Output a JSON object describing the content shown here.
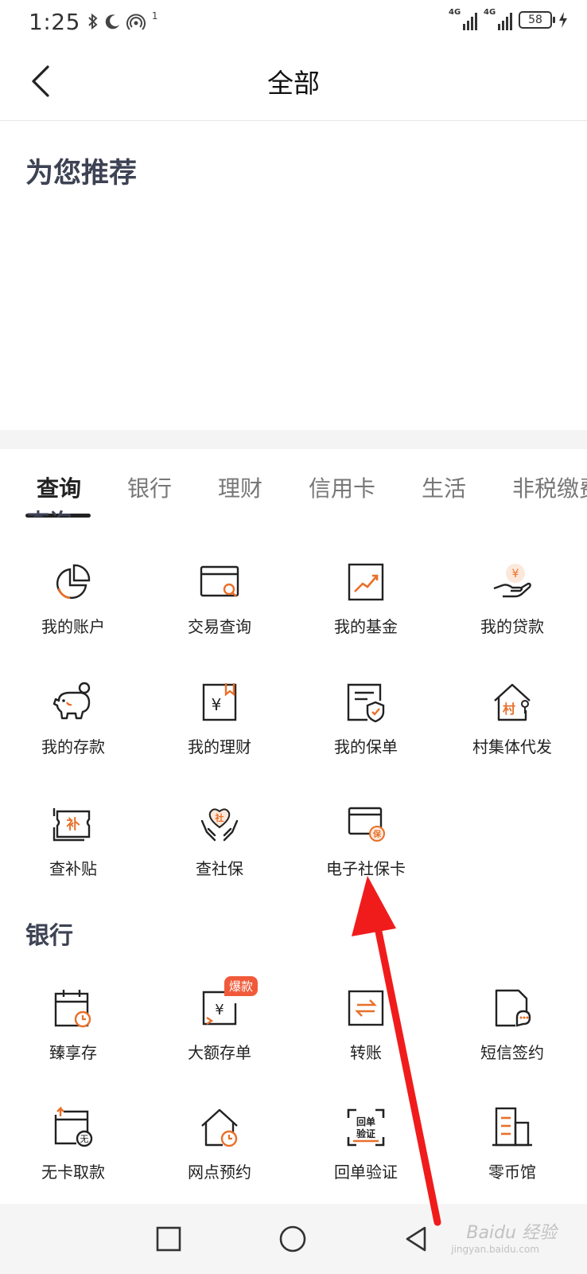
{
  "status_bar": {
    "time": "1:25",
    "left_icons": [
      "bluetooth-icon",
      "moon-icon",
      "hotspot-icon"
    ],
    "hotspot_count": "1",
    "network_tag_1": "4G",
    "network_tag_2": "4G",
    "battery": "58",
    "charging": true
  },
  "header": {
    "title": "全部"
  },
  "recommend": {
    "title": "为您推荐"
  },
  "tabs": [
    {
      "label": "查询",
      "active": true
    },
    {
      "label": "银行",
      "active": false
    },
    {
      "label": "理财",
      "active": false
    },
    {
      "label": "信用卡",
      "active": false
    },
    {
      "label": "生活",
      "active": false
    },
    {
      "label": "非税缴费",
      "active": false
    }
  ],
  "ghost_heading": "查询",
  "sections": [
    {
      "title": "",
      "items": [
        {
          "label": "我的账户",
          "icon": "pie-chart-icon"
        },
        {
          "label": "交易查询",
          "icon": "card-search-icon"
        },
        {
          "label": "我的基金",
          "icon": "trend-chart-icon"
        },
        {
          "label": "我的贷款",
          "icon": "hand-coin-icon"
        },
        {
          "label": "我的存款",
          "icon": "piggy-bank-icon"
        },
        {
          "label": "我的理财",
          "icon": "yuan-bookmark-icon"
        },
        {
          "label": "我的保单",
          "icon": "policy-shield-icon"
        },
        {
          "label": "村集体代发",
          "icon": "village-house-icon"
        },
        {
          "label": "查补贴",
          "icon": "subsidy-ticket-icon"
        },
        {
          "label": "查社保",
          "icon": "social-security-heart-icon"
        },
        {
          "label": "电子社保卡",
          "icon": "social-security-card-icon"
        }
      ]
    },
    {
      "title": "银行",
      "items": [
        {
          "label": "臻享存",
          "icon": "calendar-clock-icon"
        },
        {
          "label": "大额存单",
          "icon": "deposit-certificate-icon",
          "badge": "爆款"
        },
        {
          "label": "转账",
          "icon": "transfer-icon"
        },
        {
          "label": "短信签约",
          "icon": "sms-document-icon"
        },
        {
          "label": "无卡取款",
          "icon": "cardless-withdraw-icon"
        },
        {
          "label": "网点预约",
          "icon": "branch-appointment-icon"
        },
        {
          "label": "回单验证",
          "icon": "receipt-verify-icon",
          "icon_text": "回单验证"
        },
        {
          "label": "零币馆",
          "icon": "coin-building-icon"
        }
      ]
    }
  ],
  "icon_glyphs": {
    "yuan": "¥",
    "village": "村",
    "subsidy": "补",
    "social": "社",
    "bao": "保",
    "wu": "无"
  },
  "bottom_nav": [
    "recent-apps-icon",
    "home-icon",
    "back-triangle-icon"
  ],
  "watermark": {
    "text": "Baidu 经验",
    "sub": "jingyan.baidu.com"
  },
  "colors": {
    "accent": "#e8702a",
    "title_slate": "#3d4254",
    "arrow_red": "#f01c1c",
    "badge": "#f05a3a"
  }
}
